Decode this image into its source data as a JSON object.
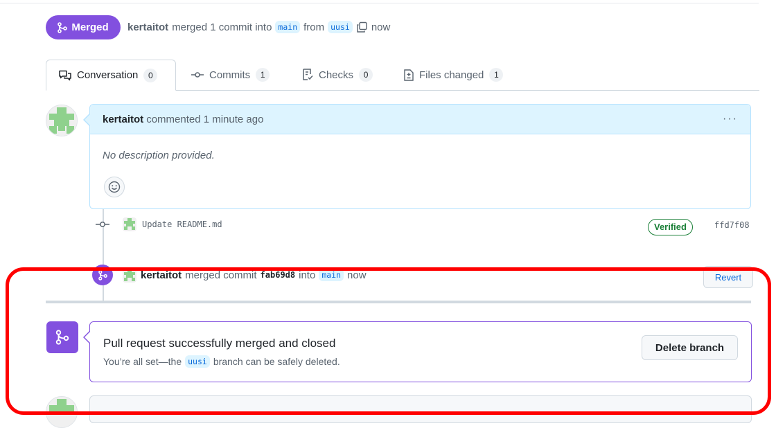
{
  "header": {
    "state_label": "Merged",
    "author": "kertaitot",
    "text_merged": "merged 1 commit into",
    "base_branch": "main",
    "text_from": "from",
    "head_branch": "uusi",
    "time": "now"
  },
  "tabs": [
    {
      "label": "Conversation",
      "count": "0",
      "icon": "comment-discussion-icon"
    },
    {
      "label": "Commits",
      "count": "1",
      "icon": "git-commit-icon"
    },
    {
      "label": "Checks",
      "count": "0",
      "icon": "checklist-icon"
    },
    {
      "label": "Files changed",
      "count": "1",
      "icon": "file-diff-icon"
    }
  ],
  "comment": {
    "author": "kertaitot",
    "action": "commented 1 minute ago",
    "body": "No description provided.",
    "menu": "···"
  },
  "commit": {
    "message": "Update README.md",
    "badge": "Verified",
    "sha": "ffd7f08"
  },
  "merge_event": {
    "author": "kertaitot",
    "text_merged_commit": "merged commit",
    "sha": "fab69d8",
    "text_into": "into",
    "branch": "main",
    "time": "now",
    "revert_label": "Revert"
  },
  "merged_box": {
    "title": "Pull request successfully merged and closed",
    "sub_prefix": "You’re all set—the",
    "branch": "uusi",
    "sub_suffix": "branch can be safely deleted.",
    "delete_label": "Delete branch"
  },
  "colors": {
    "merged_purple": "#8250df",
    "link_blue": "#0969da",
    "verified_green": "#1a7f37",
    "highlight_red": "#ff0000"
  }
}
